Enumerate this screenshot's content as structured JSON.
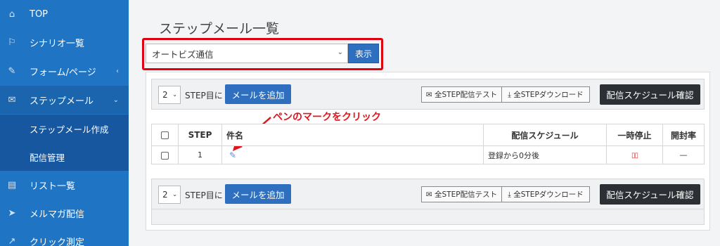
{
  "sidebar": {
    "items": [
      {
        "label": "TOP",
        "icon": "home-icon"
      },
      {
        "label": "シナリオ一覧",
        "icon": "flag-icon"
      },
      {
        "label": "フォーム/ページ",
        "icon": "pen-icon",
        "chevron": "‹"
      },
      {
        "label": "ステップメール",
        "icon": "mail-icon",
        "chevron": "⌄"
      },
      {
        "label": "ステップメール作成"
      },
      {
        "label": "配信管理"
      },
      {
        "label": "リスト一覧",
        "icon": "list-icon"
      },
      {
        "label": "メルマガ配信",
        "icon": "send-icon"
      },
      {
        "label": "クリック測定",
        "icon": "chart-icon"
      }
    ]
  },
  "page": {
    "title": "ステップメール一覧",
    "scenario_select": "オートビズ通信",
    "show_button": "表示"
  },
  "toolbar": {
    "step_count": "2",
    "step_label": "STEP目に",
    "add_mail": "メールを追加",
    "test_all": "✉ 全STEP配信テスト",
    "download_all": "⤓ 全STEPダウンロード",
    "schedule_confirm": "配信スケジュール確認"
  },
  "annotation": "ペンのマークをクリック",
  "table": {
    "headers": [
      "",
      "STEP",
      "件名",
      "配信スケジュール",
      "一時停止",
      "開封率"
    ],
    "rows": [
      {
        "step": "1",
        "subject_icon": "✎",
        "schedule": "登録から0分後",
        "pause": "▯▯",
        "open_rate": "—"
      }
    ]
  },
  "colors": {
    "sidebar": "#1f74c4",
    "primary": "#2e6fbf",
    "dark_button": "#2c2f33",
    "annotation": "#e0151b"
  }
}
